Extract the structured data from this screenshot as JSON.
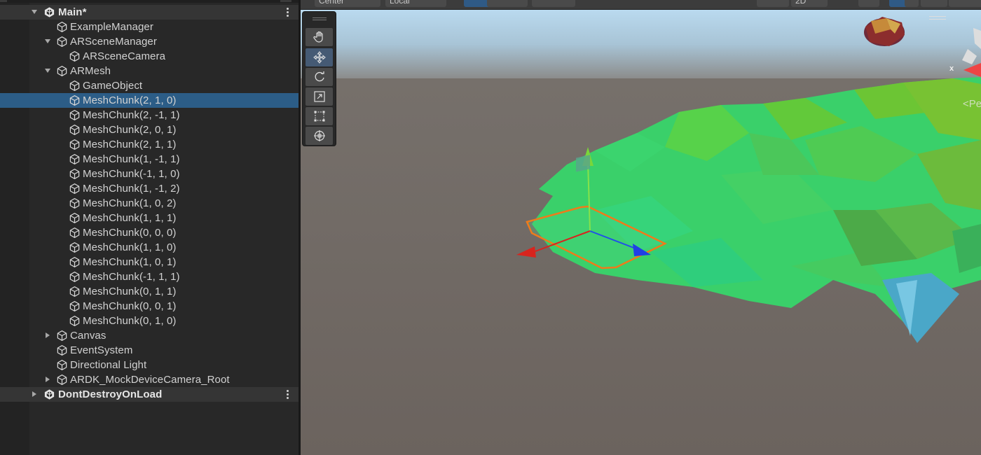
{
  "hierarchy": {
    "scenes": [
      {
        "name": "Main*",
        "expanded": true,
        "children": [
          {
            "label": "ExampleManager",
            "depth": 1,
            "arrow": "none"
          },
          {
            "label": "ARSceneManager",
            "depth": 1,
            "arrow": "down"
          },
          {
            "label": "ARSceneCamera",
            "depth": 2,
            "arrow": "none"
          },
          {
            "label": "ARMesh",
            "depth": 1,
            "arrow": "down"
          },
          {
            "label": "GameObject",
            "depth": 2,
            "arrow": "none"
          },
          {
            "label": "MeshChunk(2, 1, 0)",
            "depth": 2,
            "arrow": "none",
            "selected": true
          },
          {
            "label": "MeshChunk(2, -1, 1)",
            "depth": 2,
            "arrow": "none"
          },
          {
            "label": "MeshChunk(2, 0, 1)",
            "depth": 2,
            "arrow": "none"
          },
          {
            "label": "MeshChunk(2, 1, 1)",
            "depth": 2,
            "arrow": "none"
          },
          {
            "label": "MeshChunk(1, -1, 1)",
            "depth": 2,
            "arrow": "none"
          },
          {
            "label": "MeshChunk(-1, 1, 0)",
            "depth": 2,
            "arrow": "none"
          },
          {
            "label": "MeshChunk(1, -1, 2)",
            "depth": 2,
            "arrow": "none"
          },
          {
            "label": "MeshChunk(1, 0, 2)",
            "depth": 2,
            "arrow": "none"
          },
          {
            "label": "MeshChunk(1, 1, 1)",
            "depth": 2,
            "arrow": "none"
          },
          {
            "label": "MeshChunk(0, 0, 0)",
            "depth": 2,
            "arrow": "none"
          },
          {
            "label": "MeshChunk(1, 1, 0)",
            "depth": 2,
            "arrow": "none"
          },
          {
            "label": "MeshChunk(1, 0, 1)",
            "depth": 2,
            "arrow": "none"
          },
          {
            "label": "MeshChunk(-1, 1, 1)",
            "depth": 2,
            "arrow": "none"
          },
          {
            "label": "MeshChunk(0, 1, 1)",
            "depth": 2,
            "arrow": "none"
          },
          {
            "label": "MeshChunk(0, 0, 1)",
            "depth": 2,
            "arrow": "none"
          },
          {
            "label": "MeshChunk(0, 1, 0)",
            "depth": 2,
            "arrow": "none"
          },
          {
            "label": "Canvas",
            "depth": 1,
            "arrow": "right"
          },
          {
            "label": "EventSystem",
            "depth": 1,
            "arrow": "none"
          },
          {
            "label": "Directional Light",
            "depth": 1,
            "arrow": "none"
          },
          {
            "label": "ARDK_MockDeviceCamera_Root",
            "depth": 1,
            "arrow": "right"
          }
        ]
      },
      {
        "name": "DontDestroyOnLoad",
        "expanded": false,
        "children": []
      }
    ]
  },
  "scene_view": {
    "toolbar": {
      "pivot_label": "Center",
      "space_label": "Local",
      "mode_2d_label": "2D"
    },
    "tools": [
      {
        "name": "hand-tool",
        "active": false
      },
      {
        "name": "move-tool",
        "active": true
      },
      {
        "name": "rotate-tool",
        "active": false
      },
      {
        "name": "scale-tool",
        "active": false
      },
      {
        "name": "rect-tool",
        "active": false
      },
      {
        "name": "transform-tool",
        "active": false
      }
    ],
    "projection_label": "<Pe",
    "axis_label": "x",
    "colors": {
      "sky_top": "#b9dcf4",
      "horizon": "#8b8a87",
      "ground": "#6b6460",
      "mesh_green": "#35d16a",
      "selection_outline": "#f07a1a",
      "gizmo_y": "#7ad63a",
      "gizmo_x": "#d8241e",
      "gizmo_z": "#2040e6"
    }
  }
}
